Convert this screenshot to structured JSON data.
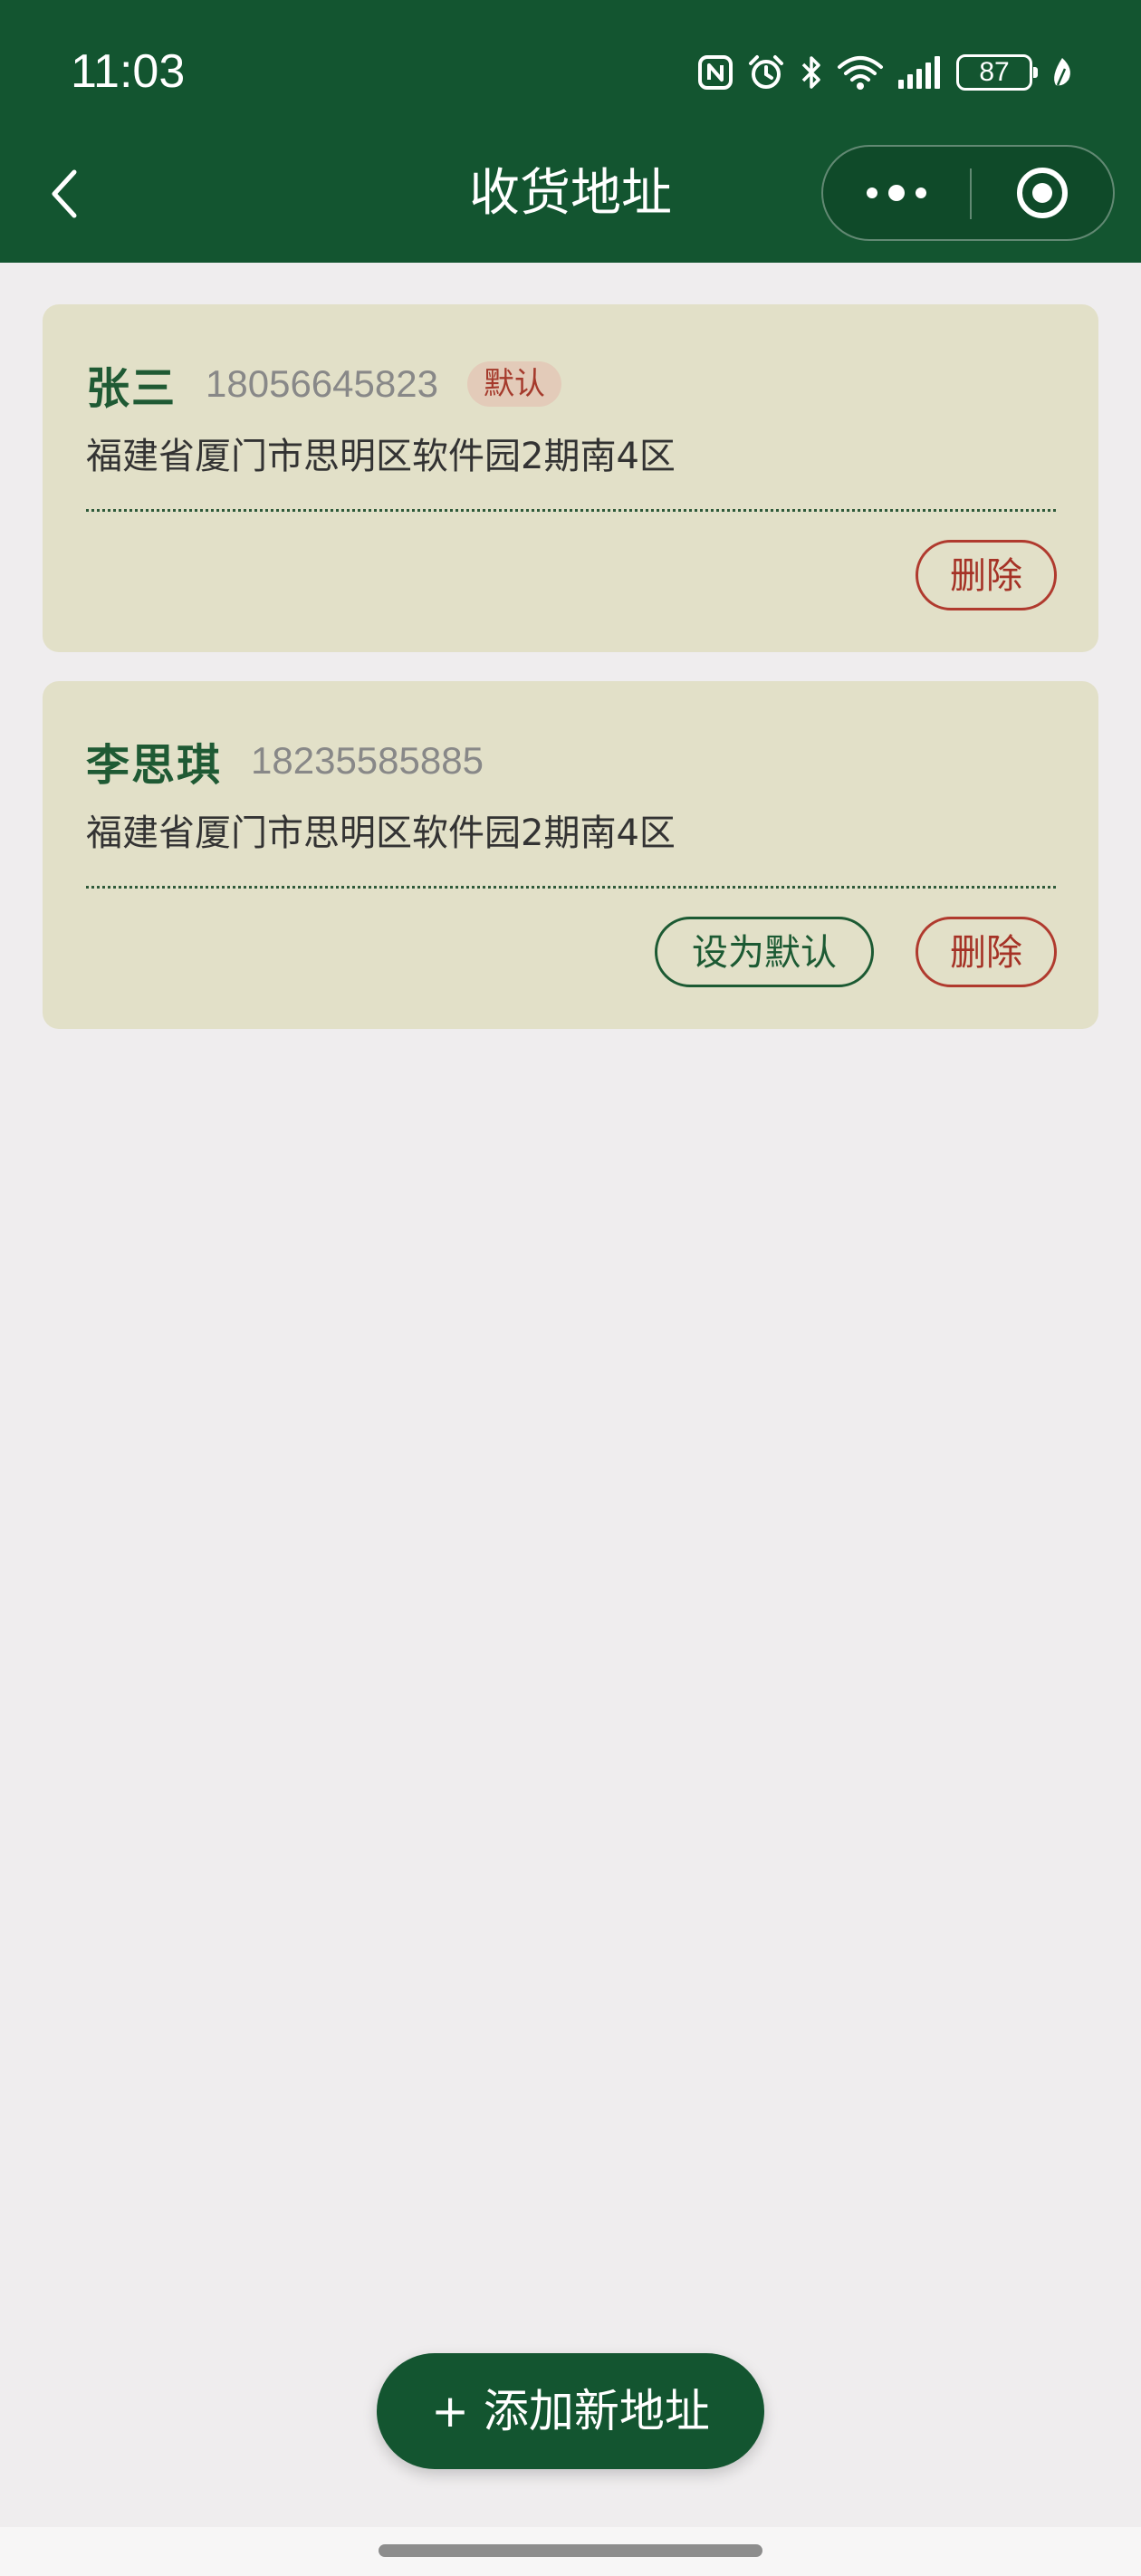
{
  "status_bar": {
    "time": "11:03",
    "battery": "87",
    "icons": [
      "nfc-icon",
      "alarm-icon",
      "bluetooth-icon",
      "wifi-icon",
      "signal-icon",
      "battery-icon",
      "leaf-icon"
    ]
  },
  "nav": {
    "title": "收货地址",
    "back_icon": "chevron-left-icon",
    "more_icon": "more-dots-icon",
    "close_icon": "target-circle-icon"
  },
  "addresses": [
    {
      "name": "张三",
      "phone": "18056645823",
      "badge": "默认",
      "address": "福建省厦门市思明区软件园2期南4区",
      "delete_label": "删除"
    },
    {
      "name": "李思琪",
      "phone": "18235585885",
      "address": "福建省厦门市思明区软件园2期南4区",
      "set_default_label": "设为默认",
      "delete_label": "删除"
    }
  ],
  "add_button": {
    "label": "+ 添加新地址"
  },
  "colors": {
    "brand_green": "#135530",
    "card_bg": "#e2e0c8",
    "page_bg": "#efedee",
    "danger_red": "#b03a2e",
    "badge_bg": "#e3cbb9"
  }
}
